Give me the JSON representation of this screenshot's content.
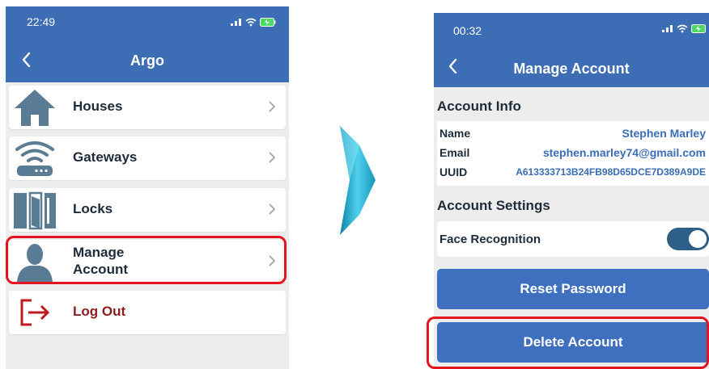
{
  "left_screen": {
    "status_time": "22:49",
    "nav_title": "Argo",
    "menu": [
      {
        "label": "Houses",
        "icon": "house-icon"
      },
      {
        "label": "Gateways",
        "icon": "gateway-icon"
      },
      {
        "label": "Locks",
        "icon": "locks-icon"
      },
      {
        "label": "Manage Account",
        "icon": "user-icon"
      },
      {
        "label": "Log Out",
        "icon": "logout-icon"
      }
    ]
  },
  "right_screen": {
    "status_time": "00:32",
    "nav_title": "Manage Account",
    "account_info_header": "Account Info",
    "account_info": {
      "name_label": "Name",
      "name_value": "Stephen Marley",
      "email_label": "Email",
      "email_value": "stephen.marley74@gmail.com",
      "uuid_label": "UUID",
      "uuid_value": "A613333713B24FB98D65DCE7D389A9DE"
    },
    "account_settings_header": "Account Settings",
    "face_recognition_label": "Face Recognition",
    "face_recognition_enabled": true,
    "reset_password_label": "Reset Password",
    "delete_account_label": "Delete Account"
  },
  "colors": {
    "header_blue": "#3d6db4",
    "button_blue": "#3f6fbf",
    "highlight_red": "#e3141e",
    "logout_red": "#8f1c1c",
    "icon_blue_gray": "#5a7b94",
    "toggle_on": "#2e5f86"
  }
}
